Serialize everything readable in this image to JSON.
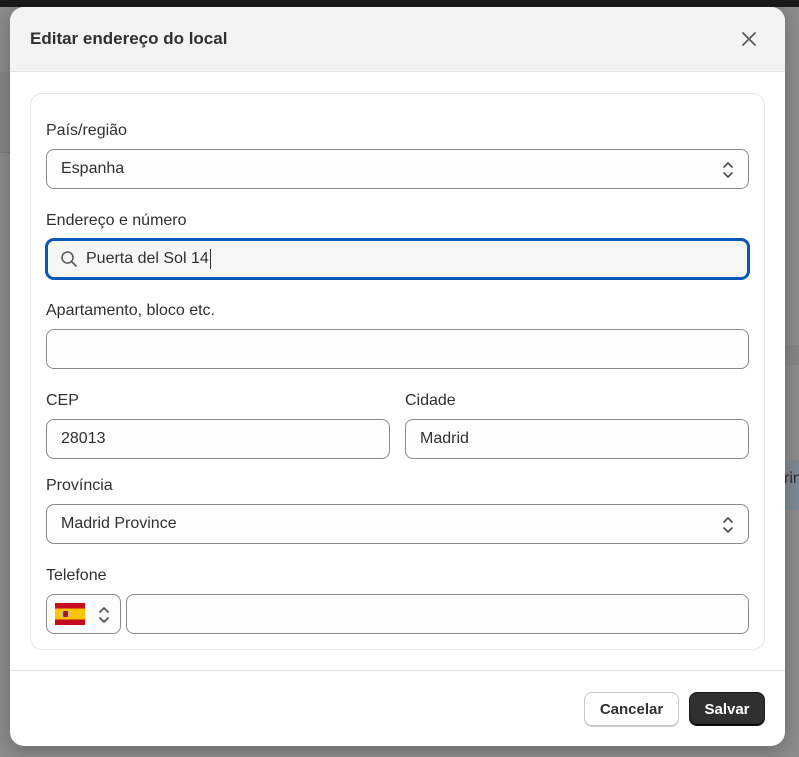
{
  "background": {
    "partial_text": "rin"
  },
  "modal": {
    "title": "Editar endereço do local",
    "close_icon": "close-icon"
  },
  "form": {
    "country": {
      "label": "País/região",
      "value": "Espanha"
    },
    "address": {
      "label": "Endereço e número",
      "value": "Puerta del Sol 14",
      "icon": "search-icon"
    },
    "apartment": {
      "label": "Apartamento, bloco etc.",
      "value": ""
    },
    "postal_code": {
      "label": "CEP",
      "value": "28013"
    },
    "city": {
      "label": "Cidade",
      "value": "Madrid"
    },
    "province": {
      "label": "Província",
      "value": "Madrid Province"
    },
    "phone": {
      "label": "Telefone",
      "value": "",
      "country_flag": "spain-flag-icon"
    }
  },
  "footer": {
    "cancel_label": "Cancelar",
    "save_label": "Salvar"
  },
  "colors": {
    "focus_ring": "#0b57b8",
    "primary_button": "#303030",
    "overlay": "#8c8c8c"
  }
}
